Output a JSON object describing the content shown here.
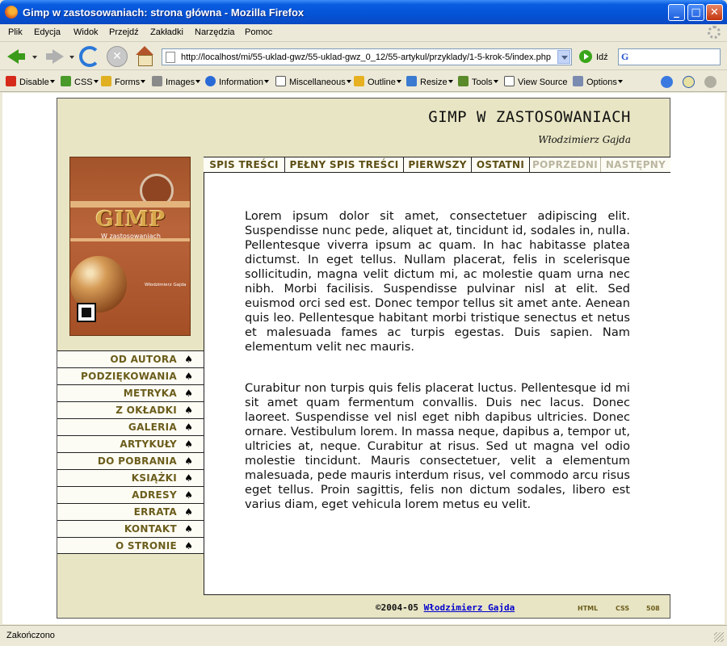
{
  "window": {
    "title": "Gimp w zastosowaniach: strona główna - Mozilla Firefox",
    "controls": {
      "minimize": "_",
      "maximize": "□",
      "close": "✕"
    }
  },
  "menubar": [
    "Plik",
    "Edycja",
    "Widok",
    "Przejdź",
    "Zakładki",
    "Narzędzia",
    "Pomoc"
  ],
  "navbar": {
    "url": "http://localhost/mi/55-uklad-gwz/55-uklad-gwz_0_12/55-artykul/przyklady/1-5-krok-5/index.php",
    "go_label": "Idź",
    "stop_glyph": "✕",
    "search_value": ""
  },
  "devbar": [
    "Disable",
    "CSS",
    "Forms",
    "Images",
    "Information",
    "Miscellaneous",
    "Outline",
    "Resize",
    "Tools",
    "View Source",
    "Options"
  ],
  "site": {
    "title": "GIMP W ZASTOSOWANIACH",
    "author": "Włodzimierz Gajda",
    "cover": {
      "title": "GIMP",
      "subtitle": "W zastosowaniach",
      "author": "Włodzimierz Gajda"
    },
    "left_menu": [
      "OD AUTORA",
      "PODZIĘKOWANIA",
      "METRYKA",
      "Z OKŁADKI",
      "GALERIA",
      "ARTYKUŁY",
      "DO POBRANIA",
      "KSIĄŻKI",
      "ADRESY",
      "ERRATA",
      "KONTAKT",
      "O STRONIE"
    ],
    "top_nav": [
      {
        "label": "SPIS TREŚCI",
        "enabled": true
      },
      {
        "label": "PEŁNY SPIS TREŚCI",
        "enabled": true
      },
      {
        "label": "PIERWSZY",
        "enabled": true
      },
      {
        "label": "OSTATNI",
        "enabled": true
      },
      {
        "label": "POPRZEDNI",
        "enabled": false
      },
      {
        "label": "NASTĘPNY",
        "enabled": false
      }
    ],
    "paragraphs": [
      "Lorem ipsum dolor sit amet, consectetuer adipiscing elit. Suspendisse nunc pede, aliquet at, tincidunt id, sodales in, nulla. Pellentesque viverra ipsum ac quam. In hac habitasse platea dictumst. In eget tellus. Nullam placerat, felis in scelerisque sollicitudin, magna velit dictum mi, ac molestie quam urna nec nibh. Morbi facilisis. Suspendisse pulvinar nisl at elit. Sed euismod orci sed est. Donec tempor tellus sit amet ante. Aenean quis leo. Pellentesque habitant morbi tristique senectus et netus et malesuada fames ac turpis egestas. Duis sapien. Nam elementum velit nec mauris.",
      "Curabitur non turpis quis felis placerat luctus. Pellentesque id mi sit amet quam fermentum convallis. Duis nec lacus. Donec laoreet. Suspendisse vel nisl eget nibh dapibus ultricies. Donec ornare. Vestibulum lorem. In massa neque, dapibus a, tempor ut, ultricies at, neque. Curabitur at risus. Sed ut magna vel odio molestie tincidunt. Mauris consectetuer, velit a elementum malesuada, pede mauris interdum risus, vel commodo arcu risus eget tellus. Proin sagittis, felis non dictum sodales, libero est varius diam, eget vehicula lorem metus eu velit."
    ],
    "footer": {
      "copyright": "©2004-05",
      "author_link": "Włodzimierz Gajda",
      "badges": [
        "HTML",
        "CSS",
        "508"
      ]
    },
    "colors": {
      "page_bg": "#e8e5c4",
      "menu_text": "#6b5d1c",
      "disabled_text": "#bbb6a0",
      "link": "#0000cc"
    }
  },
  "statusbar": {
    "text": "Zakończono"
  }
}
